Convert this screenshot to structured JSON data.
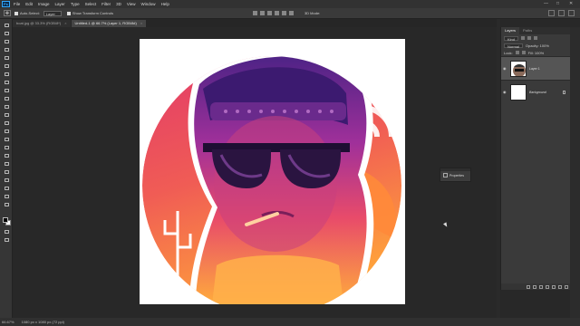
{
  "app": {
    "logo": "Ps"
  },
  "menu": [
    "File",
    "Edit",
    "Image",
    "Layer",
    "Type",
    "Select",
    "Filter",
    "3D",
    "View",
    "Window",
    "Help"
  ],
  "window_controls": [
    "—",
    "□",
    "✕"
  ],
  "options": {
    "auto_select_label": "Auto-Select:",
    "auto_select_value": "Layer",
    "transform_label": "Show Transform Controls",
    "mode_3d": "3D Mode:"
  },
  "tabs": [
    {
      "label": "boat.jpg @ 33.3% (RGB/8*)",
      "active": false
    },
    {
      "label": "Untitled-1 @ 66.7% (Layer 1, RGB/8#)",
      "active": true
    }
  ],
  "properties_panel": {
    "label": "Properties"
  },
  "layers_panel": {
    "tabs": [
      "Layers",
      "Paths"
    ],
    "filter_label": "Kind",
    "blend_mode": "Normal",
    "opacity_label": "Opacity: 100%",
    "lock_label": "Lock:",
    "fill_label": "Fill: 100%",
    "layers": [
      {
        "name": "Layer 1",
        "selected": true,
        "visible": true
      },
      {
        "name": "Background",
        "selected": false,
        "visible": true
      }
    ]
  },
  "status": {
    "zoom": "66.67%",
    "doc_info": "1080 px x 1080 px (72 ppi)"
  },
  "colors": {
    "gradient_top": "#5a2a9a",
    "gradient_mid": "#e8386a",
    "gradient_bottom": "#ffa23a",
    "accent": "#31a8ff"
  }
}
